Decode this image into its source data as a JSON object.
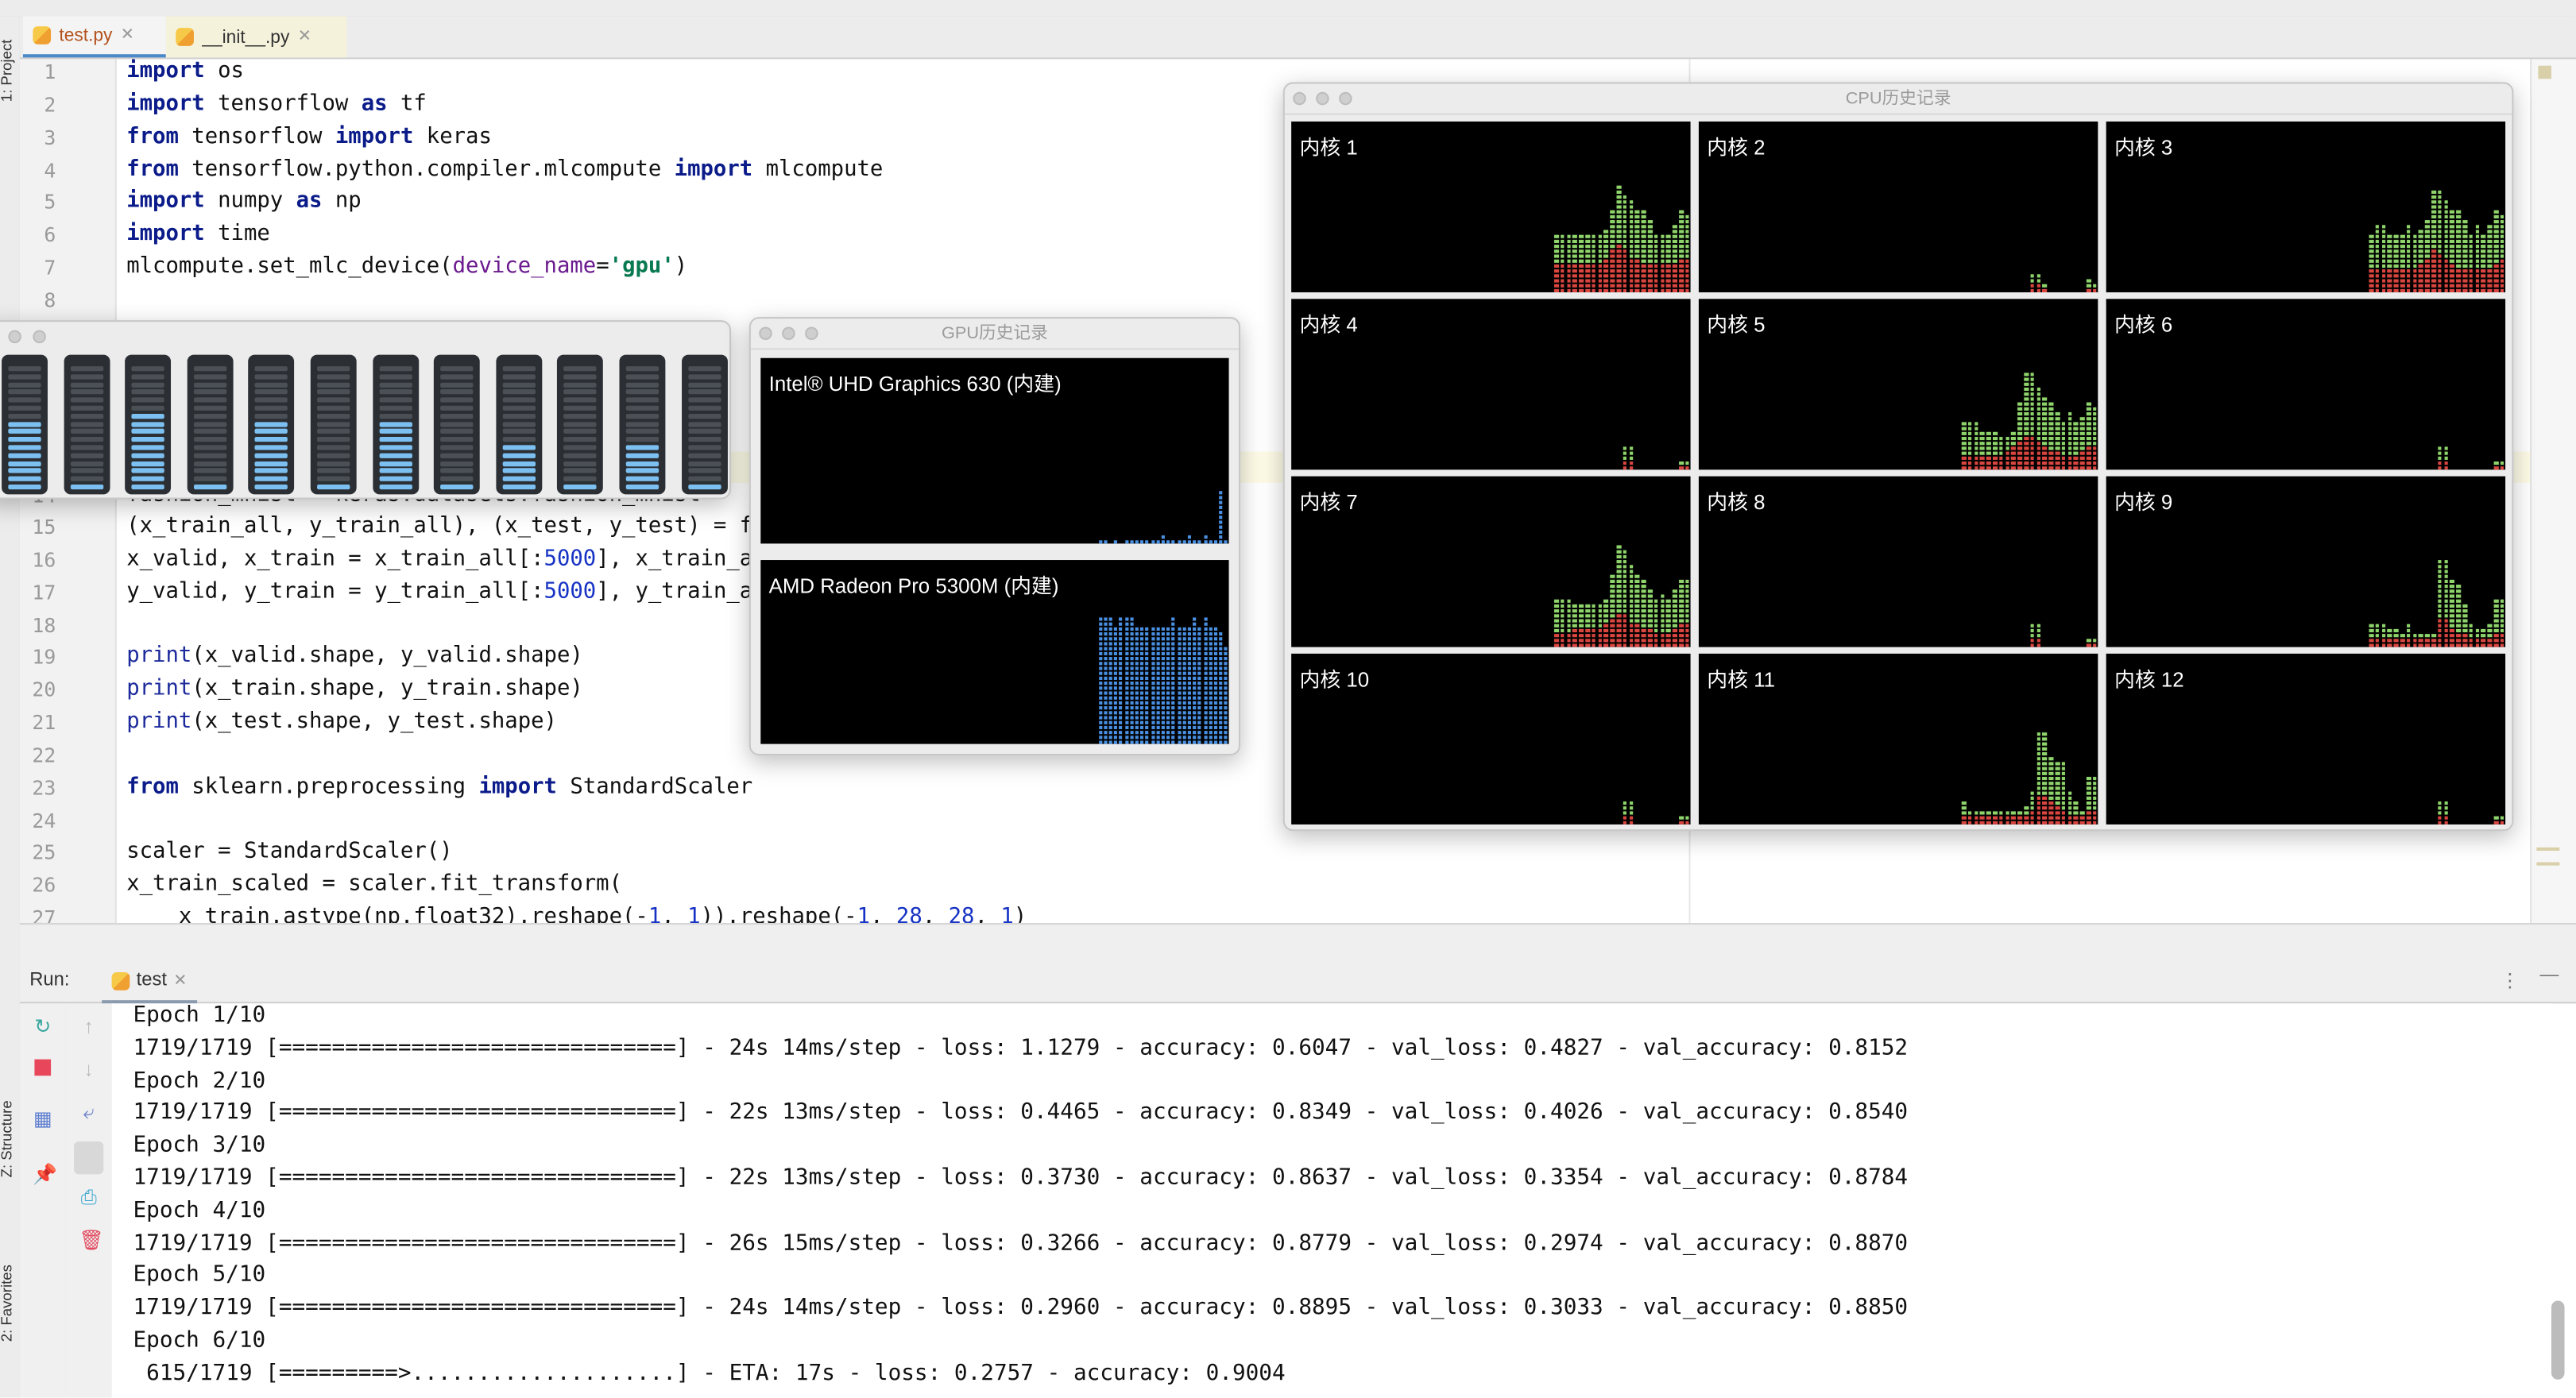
{
  "editor": {
    "tabs": [
      {
        "label": "test.py",
        "active": true,
        "icon": "python-file-icon"
      },
      {
        "label": "__init__.py",
        "active": false,
        "icon": "python-file-icon"
      }
    ],
    "lines": [
      {
        "n": "1",
        "tokens": [
          [
            "import",
            "kw"
          ],
          [
            " os",
            ""
          ]
        ]
      },
      {
        "n": "2",
        "tokens": [
          [
            "import",
            "kw"
          ],
          [
            " tensorflow ",
            ""
          ],
          [
            "as",
            "kw"
          ],
          [
            " tf",
            ""
          ]
        ]
      },
      {
        "n": "3",
        "tokens": [
          [
            "from",
            "kw"
          ],
          [
            " tensorflow ",
            ""
          ],
          [
            "import",
            "kw"
          ],
          [
            " keras",
            ""
          ]
        ]
      },
      {
        "n": "4",
        "tokens": [
          [
            "from",
            "kw"
          ],
          [
            " tensorflow.python.compiler.mlcompute ",
            ""
          ],
          [
            "import",
            "kw"
          ],
          [
            " mlcompute",
            ""
          ]
        ]
      },
      {
        "n": "5",
        "tokens": [
          [
            "import",
            "kw"
          ],
          [
            " numpy ",
            ""
          ],
          [
            "as",
            "kw"
          ],
          [
            " np",
            ""
          ]
        ]
      },
      {
        "n": "6",
        "tokens": [
          [
            "import",
            "kw"
          ],
          [
            " time",
            ""
          ]
        ]
      },
      {
        "n": "7",
        "tokens": [
          [
            "mlcompute.set_mlc_device(",
            ""
          ],
          [
            "device_name",
            "param"
          ],
          [
            "=",
            ""
          ],
          [
            "'gpu'",
            "str"
          ],
          [
            ")",
            ""
          ]
        ]
      },
      {
        "n": "8",
        "tokens": []
      },
      {
        "n": "14",
        "tokens": [
          [
            "fashion_mnist = keras.datasets.fashion_mnist",
            ""
          ]
        ]
      },
      {
        "n": "15",
        "tokens": [
          [
            "(x_train_all, y_train_all), (x_test, y_test) = f",
            ""
          ]
        ]
      },
      {
        "n": "16",
        "tokens": [
          [
            "x_valid, x_train = x_train_all[:",
            ""
          ],
          [
            "5000",
            "num"
          ],
          [
            "], x_train_a",
            ""
          ]
        ]
      },
      {
        "n": "17",
        "tokens": [
          [
            "y_valid, y_train = y_train_all[:",
            ""
          ],
          [
            "5000",
            "num"
          ],
          [
            "], y_train_a",
            ""
          ]
        ]
      },
      {
        "n": "18",
        "tokens": []
      },
      {
        "n": "19",
        "tokens": [
          [
            "print",
            "builtin"
          ],
          [
            "(x_valid.shape, y_valid.shape)",
            ""
          ]
        ]
      },
      {
        "n": "20",
        "tokens": [
          [
            "print",
            "builtin"
          ],
          [
            "(x_train.shape, y_train.shape)",
            ""
          ]
        ]
      },
      {
        "n": "21",
        "tokens": [
          [
            "print",
            "builtin"
          ],
          [
            "(x_test.shape, y_test.shape)",
            ""
          ]
        ]
      },
      {
        "n": "22",
        "tokens": []
      },
      {
        "n": "23",
        "tokens": [
          [
            "from",
            "kw"
          ],
          [
            " sklearn.preprocessing ",
            ""
          ],
          [
            "import",
            "kw"
          ],
          [
            " StandardScaler",
            ""
          ]
        ]
      },
      {
        "n": "24",
        "tokens": []
      },
      {
        "n": "25",
        "tokens": [
          [
            "scaler = StandardScaler()",
            ""
          ]
        ]
      },
      {
        "n": "26",
        "tokens": [
          [
            "x_train_scaled = scaler.fit_transform(",
            ""
          ]
        ]
      },
      {
        "n": "27",
        "tokens": [
          [
            "    x_train.astype(np.float32).reshape(-",
            ""
          ],
          [
            "1",
            "num"
          ],
          [
            ", ",
            ""
          ],
          [
            "1",
            "num"
          ],
          [
            ")).reshape(-",
            ""
          ],
          [
            "1",
            "num"
          ],
          [
            ", ",
            ""
          ],
          [
            "28",
            "num"
          ],
          [
            ", ",
            ""
          ],
          [
            "28",
            "num"
          ],
          [
            ", ",
            ""
          ],
          [
            "1",
            "num"
          ],
          [
            ")",
            ""
          ]
        ]
      }
    ]
  },
  "left_tool_windows": [
    "1: Project",
    "Z: Structure",
    "2: Favorites"
  ],
  "run": {
    "label": "Run:",
    "tab": "test",
    "output": [
      "Epoch 1/10",
      "1719/1719 [==============================] - 24s 14ms/step - loss: 1.1279 - accuracy: 0.6047 - val_loss: 0.4827 - val_accuracy: 0.8152",
      "Epoch 2/10",
      "1719/1719 [==============================] - 22s 13ms/step - loss: 0.4465 - accuracy: 0.8349 - val_loss: 0.4026 - val_accuracy: 0.8540",
      "Epoch 3/10",
      "1719/1719 [==============================] - 22s 13ms/step - loss: 0.3730 - accuracy: 0.8637 - val_loss: 0.3354 - val_accuracy: 0.8784",
      "Epoch 4/10",
      "1719/1719 [==============================] - 26s 15ms/step - loss: 0.3266 - accuracy: 0.8779 - val_loss: 0.2974 - val_accuracy: 0.8870",
      "Epoch 5/10",
      "1719/1719 [==============================] - 24s 14ms/step - loss: 0.2960 - accuracy: 0.8895 - val_loss: 0.3033 - val_accuracy: 0.8850",
      "Epoch 6/10",
      " 615/1719 [=========>....................] - ETA: 17s - loss: 0.2757 - accuracy: 0.9004"
    ]
  },
  "cpu_load_window": {
    "bar_color": "#7cc0f2",
    "levels_percent": [
      56,
      6,
      62,
      6,
      56,
      6,
      56,
      6,
      38,
      6,
      38,
      6
    ]
  },
  "gpu_history": {
    "title": "GPU历史记录",
    "color": "#4a90e2",
    "gpus": [
      {
        "name": "Intel® UHD Graphics 630 (内建)",
        "history_percent": [
          2,
          4,
          0,
          3,
          0,
          3,
          3,
          3,
          3,
          3,
          3,
          3,
          6,
          3,
          3,
          3,
          3,
          6,
          3,
          3,
          6,
          3,
          3,
          30,
          3
        ]
      },
      {
        "name": "AMD Radeon Pro 5300M (内建)",
        "history_percent": [
          70,
          70,
          70,
          66,
          70,
          70,
          70,
          66,
          66,
          66,
          66,
          66,
          66,
          66,
          70,
          66,
          66,
          66,
          70,
          66,
          70,
          66,
          66,
          62,
          55
        ]
      }
    ]
  },
  "cpu_history": {
    "title": "CPU历史记录",
    "user_color": "#8ed46b",
    "system_color": "#d9453f",
    "cores": [
      {
        "label": "内核 1",
        "total": [
          36,
          36,
          36,
          36,
          36,
          36,
          36,
          36,
          38,
          50,
          64,
          60,
          55,
          50,
          50,
          45,
          36,
          36,
          36,
          40,
          50,
          48
        ],
        "system": [
          17,
          17,
          17,
          17,
          17,
          17,
          17,
          17,
          20,
          25,
          28,
          25,
          22,
          20,
          18,
          18,
          17,
          17,
          17,
          18,
          20,
          22
        ]
      },
      {
        "label": "内核 2",
        "total": [
          0,
          0,
          0,
          0,
          0,
          0,
          0,
          0,
          0,
          0,
          0,
          13,
          13,
          5,
          0,
          0,
          1,
          0,
          0,
          0,
          8,
          5
        ],
        "system": [
          0,
          0,
          0,
          0,
          0,
          0,
          0,
          0,
          0,
          0,
          0,
          5,
          5,
          3,
          0,
          0,
          1,
          0,
          0,
          0,
          3,
          3
        ]
      },
      {
        "label": "内核 3",
        "total": [
          36,
          40,
          40,
          36,
          36,
          36,
          40,
          36,
          38,
          45,
          62,
          62,
          55,
          50,
          50,
          45,
          36,
          40,
          36,
          40,
          50,
          48
        ],
        "system": [
          15,
          15,
          15,
          15,
          15,
          15,
          15,
          15,
          18,
          22,
          25,
          24,
          20,
          18,
          16,
          16,
          15,
          15,
          15,
          16,
          18,
          20
        ]
      },
      {
        "label": "内核 4",
        "total": [
          0,
          0,
          0,
          0,
          0,
          0,
          0,
          0,
          0,
          0,
          0,
          16,
          16,
          0,
          0,
          0,
          0,
          0,
          0,
          0,
          5,
          5
        ],
        "system": [
          0,
          0,
          0,
          0,
          0,
          0,
          0,
          0,
          0,
          0,
          0,
          5,
          5,
          0,
          0,
          0,
          0,
          0,
          0,
          0,
          2,
          2
        ]
      },
      {
        "label": "内核 5",
        "total": [
          28,
          28,
          28,
          24,
          24,
          24,
          20,
          20,
          24,
          40,
          60,
          60,
          50,
          45,
          40,
          35,
          30,
          35,
          28,
          32,
          42,
          38
        ],
        "system": [
          10,
          10,
          10,
          10,
          10,
          10,
          10,
          12,
          14,
          18,
          22,
          20,
          18,
          15,
          13,
          12,
          10,
          10,
          10,
          12,
          15,
          16
        ]
      },
      {
        "label": "内核 6",
        "total": [
          0,
          0,
          0,
          0,
          0,
          0,
          0,
          0,
          0,
          0,
          0,
          16,
          16,
          0,
          0,
          0,
          0,
          0,
          0,
          0,
          5,
          5
        ],
        "system": [
          0,
          0,
          0,
          0,
          0,
          0,
          0,
          0,
          0,
          0,
          0,
          5,
          5,
          0,
          0,
          0,
          0,
          0,
          0,
          0,
          2,
          2
        ]
      },
      {
        "label": "内核 7",
        "total": [
          28,
          28,
          28,
          26,
          26,
          26,
          26,
          26,
          28,
          45,
          62,
          60,
          50,
          45,
          40,
          35,
          28,
          32,
          30,
          35,
          42,
          40
        ],
        "system": [
          10,
          10,
          10,
          12,
          12,
          12,
          12,
          12,
          14,
          18,
          20,
          20,
          16,
          14,
          12,
          12,
          10,
          10,
          10,
          12,
          14,
          16
        ]
      },
      {
        "label": "内核 8",
        "total": [
          0,
          0,
          0,
          0,
          0,
          0,
          0,
          0,
          0,
          0,
          0,
          16,
          16,
          0,
          0,
          0,
          0,
          0,
          0,
          0,
          5,
          5
        ],
        "system": [
          0,
          0,
          0,
          0,
          0,
          0,
          0,
          0,
          0,
          0,
          0,
          5,
          5,
          0,
          0,
          0,
          0,
          0,
          0,
          0,
          2,
          2
        ]
      },
      {
        "label": "内核 9",
        "total": [
          15,
          15,
          15,
          12,
          12,
          8,
          14,
          8,
          8,
          8,
          10,
          52,
          52,
          40,
          38,
          25,
          15,
          12,
          12,
          15,
          28,
          30
        ],
        "system": [
          5,
          5,
          5,
          5,
          5,
          5,
          5,
          5,
          5,
          5,
          5,
          18,
          18,
          12,
          10,
          8,
          5,
          5,
          5,
          5,
          8,
          10
        ]
      },
      {
        "label": "内核 10",
        "total": [
          0,
          0,
          0,
          0,
          0,
          0,
          0,
          0,
          0,
          0,
          0,
          16,
          16,
          0,
          0,
          0,
          0,
          0,
          0,
          0,
          5,
          5
        ],
        "system": [
          0,
          0,
          0,
          0,
          0,
          0,
          0,
          0,
          0,
          0,
          0,
          5,
          5,
          0,
          0,
          0,
          0,
          0,
          0,
          0,
          2,
          2
        ]
      },
      {
        "label": "内核 11",
        "total": [
          15,
          8,
          8,
          8,
          8,
          8,
          10,
          8,
          8,
          8,
          12,
          20,
          55,
          55,
          40,
          38,
          38,
          20,
          15,
          10,
          28,
          30
        ],
        "system": [
          5,
          5,
          5,
          5,
          5,
          5,
          5,
          5,
          5,
          5,
          5,
          10,
          18,
          18,
          14,
          12,
          10,
          6,
          5,
          5,
          8,
          10
        ]
      },
      {
        "label": "内核 12",
        "total": [
          0,
          0,
          0,
          0,
          0,
          0,
          0,
          0,
          0,
          0,
          0,
          16,
          16,
          0,
          0,
          0,
          0,
          0,
          0,
          0,
          5,
          5
        ],
        "system": [
          0,
          0,
          0,
          0,
          0,
          0,
          0,
          0,
          0,
          0,
          0,
          5,
          5,
          0,
          0,
          0,
          0,
          0,
          0,
          0,
          2,
          2
        ]
      }
    ]
  }
}
